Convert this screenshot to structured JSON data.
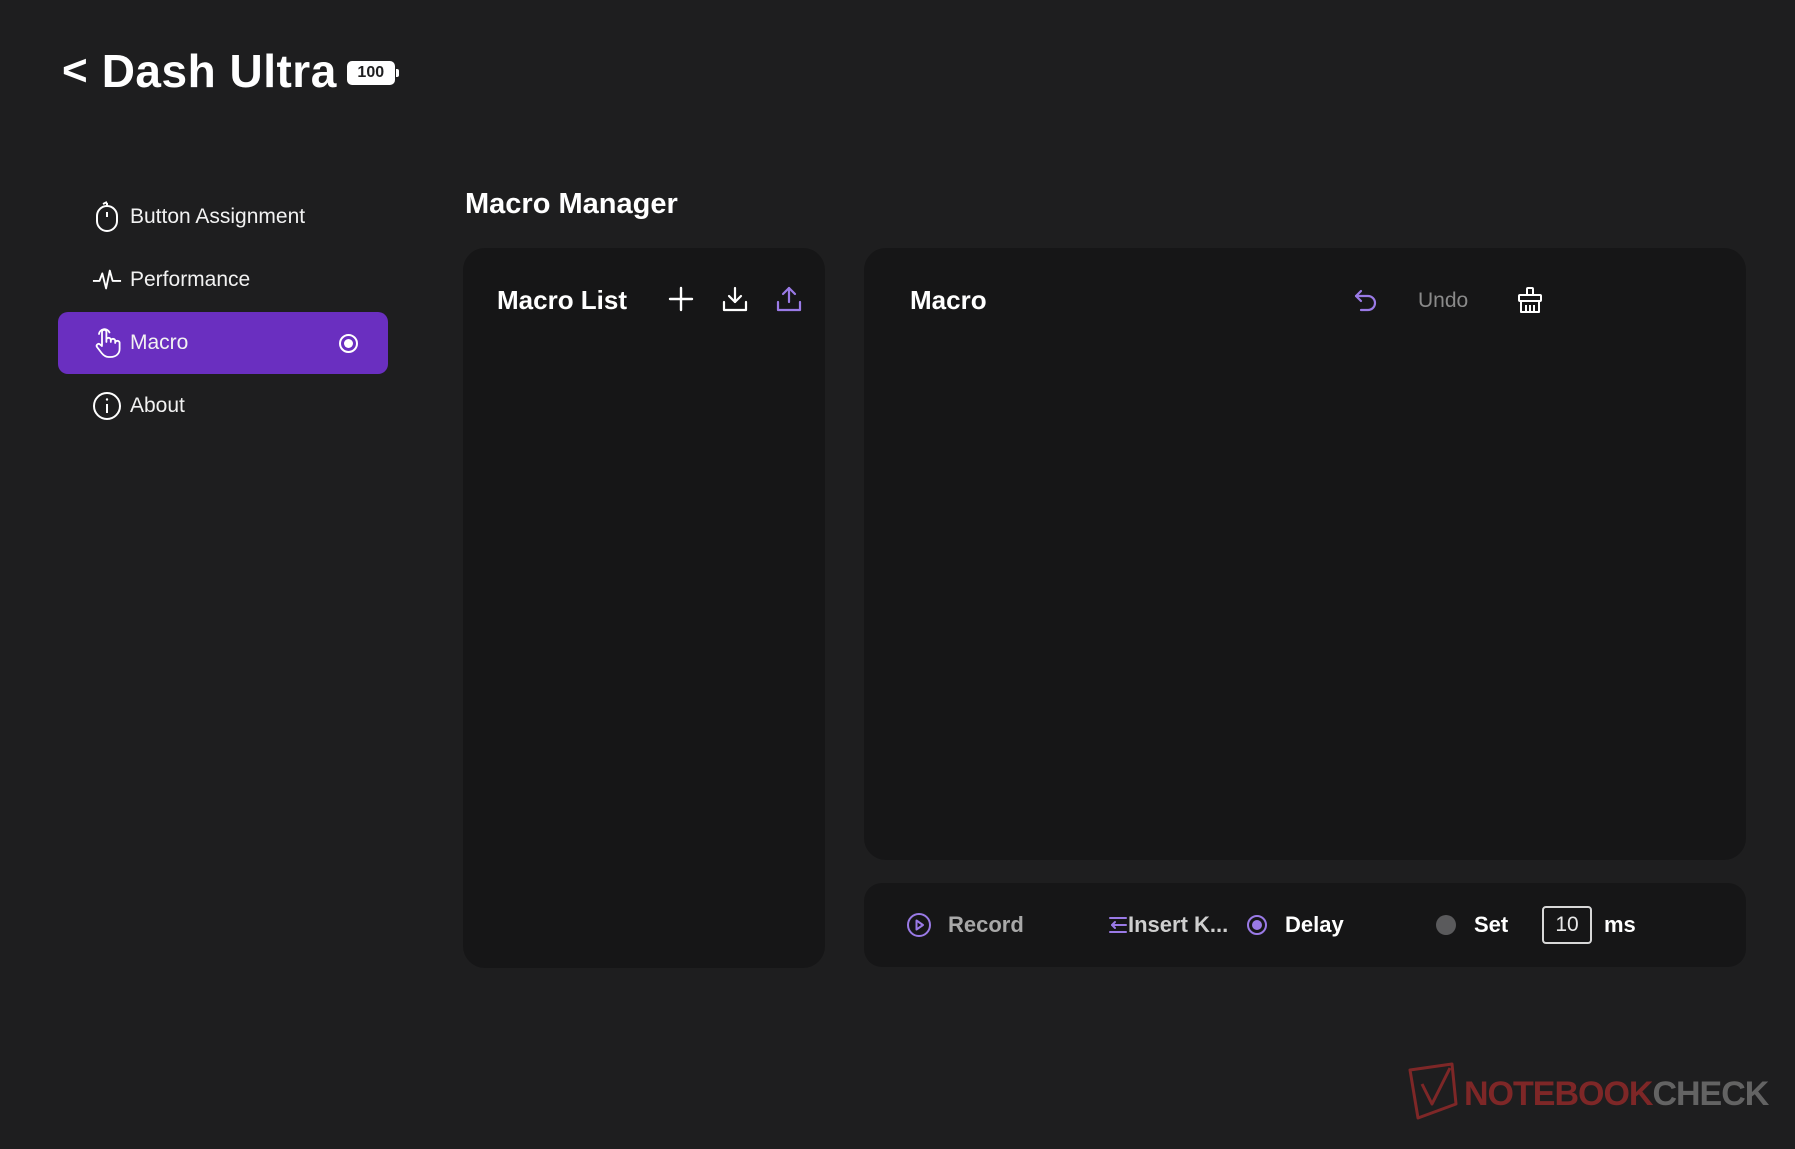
{
  "header": {
    "back_symbol": "<",
    "title": "Dash Ultra",
    "battery_level": "100"
  },
  "sidebar": {
    "items": [
      {
        "label": "Button Assignment",
        "icon": "mouse-icon",
        "active": false
      },
      {
        "label": "Performance",
        "icon": "pulse-icon",
        "active": false
      },
      {
        "label": "Macro",
        "icon": "hand-pointer-icon",
        "active": true
      },
      {
        "label": "About",
        "icon": "info-icon",
        "active": false
      }
    ]
  },
  "main": {
    "title": "Macro Manager",
    "macro_list": {
      "title": "Macro List",
      "actions": [
        "plus-icon",
        "download-icon",
        "upload-icon"
      ],
      "items": []
    },
    "macro": {
      "title": "Macro",
      "undo_label": "Undo",
      "actions": [
        "undo-icon",
        "clear-icon"
      ]
    },
    "toolbar": {
      "record_label": "Record",
      "insert_label": "Insert K...",
      "delay_label": "Delay",
      "set_label": "Set",
      "set_value": "10",
      "unit_label": "ms"
    }
  },
  "watermark": {
    "part_a": "NOTEBOOK",
    "part_b": "CHECK"
  },
  "colors": {
    "background": "#1e1e1f",
    "panel": "#161617",
    "accent": "#6a2fc0",
    "icon_accent": "#9a7ae6"
  }
}
